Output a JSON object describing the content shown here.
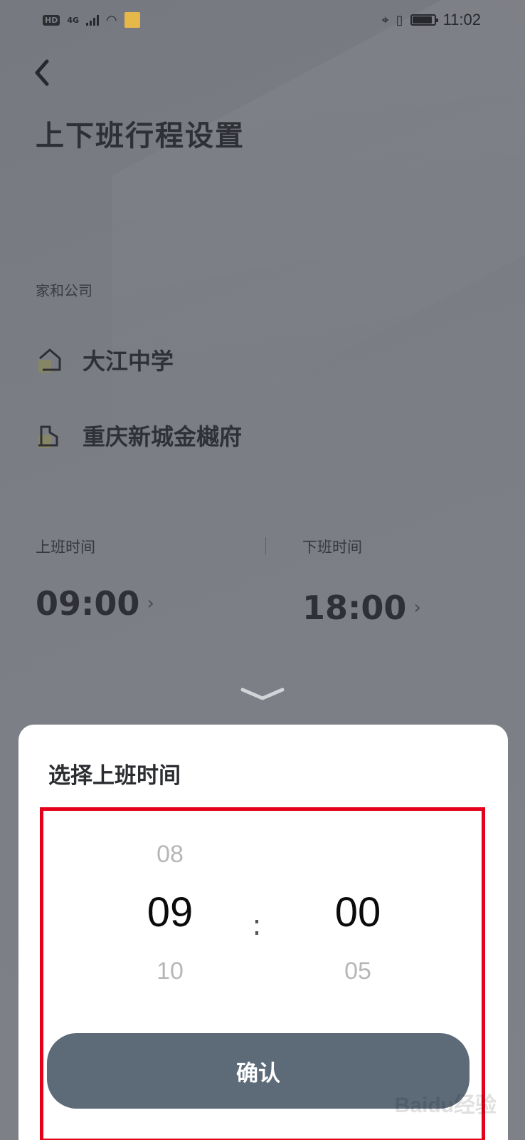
{
  "status_bar": {
    "network": "HD",
    "cell": "4G",
    "time": "11:02",
    "battery_level_percent": 90
  },
  "header": {
    "title": "上下班行程设置"
  },
  "places": {
    "section_label": "家和公司",
    "home": "大江中学",
    "work": "重庆新城金樾府"
  },
  "commute_times": {
    "start_label": "上班时间",
    "start_value": "09:00",
    "end_label": "下班时间",
    "end_value": "18:00"
  },
  "time_picker": {
    "title": "选择上班时间",
    "hours": {
      "prev": "08",
      "selected": "09",
      "next": "10"
    },
    "minutes": {
      "prev": "",
      "selected": "00",
      "next": "05"
    },
    "separator": ":",
    "confirm_label": "确认"
  },
  "watermark_text": "Baidu经验",
  "colors": {
    "overlay_dim": "#7a7d84",
    "sheet_bg": "#ffffff",
    "confirm_bg": "#5d6a78",
    "highlight_frame": "#e3001b"
  }
}
